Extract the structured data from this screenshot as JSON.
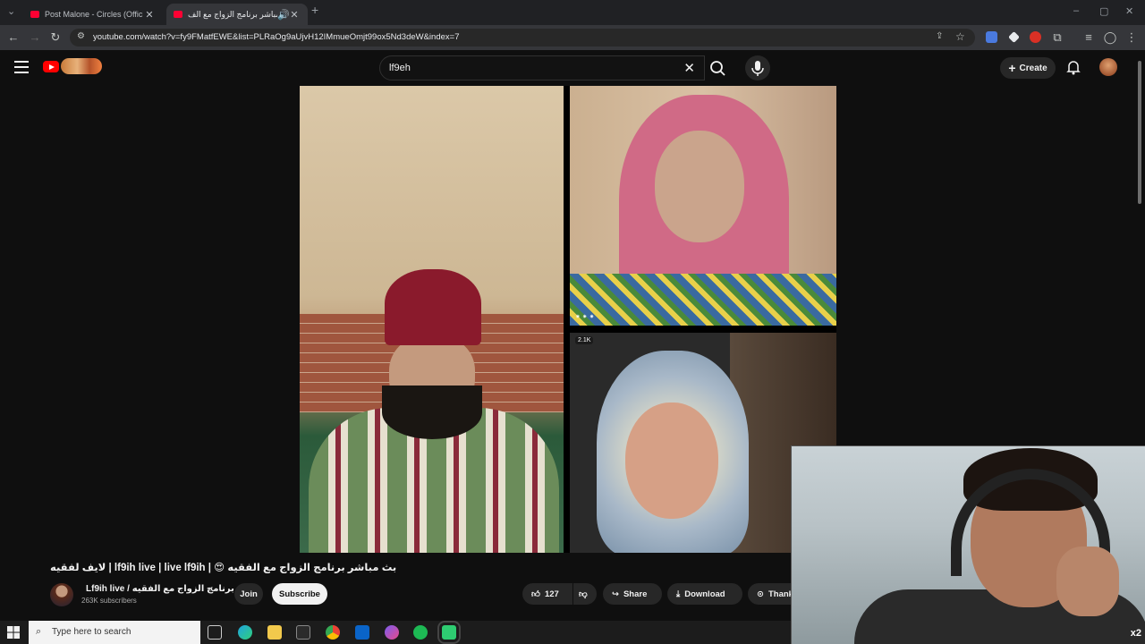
{
  "browser": {
    "tabs": [
      {
        "title": "Post Malone - Circles (Official M",
        "active": false
      },
      {
        "title": "بث مباشر برنامج الزواج مع الف",
        "active": true
      }
    ],
    "new_tab_symbol": "+",
    "url": "youtube.com/watch?v=fy9FMatfEWE&list=PLRaOg9aUjvH12IMmueOmjt99ox5Nd3deW&index=7"
  },
  "youtube": {
    "search_value": "lf9eh",
    "create_label": "Create"
  },
  "video": {
    "viewers_badge": "2.1K",
    "title": "لايف لفقيه | lf9ih live | live lf9ih | 😍 بث مباشر برنامج الزواج مع الفقيه",
    "channel_name": "Lf9ih live / برنامج الزواج مع الفقيه",
    "subscribers": "263K subscribers",
    "join_label": "Join",
    "subscribe_label": "Subscribe",
    "like_count": "127",
    "share_label": "Share",
    "download_label": "Download",
    "thanks_label": "Thank"
  },
  "webcam": {
    "speed_label": "x2"
  },
  "taskbar": {
    "search_placeholder": "Type here to search"
  },
  "icons": {
    "colors": {
      "youtube_red": "#ff0000",
      "spotify": "#1db954",
      "subscribe_bg": "#f1f1f1"
    }
  }
}
